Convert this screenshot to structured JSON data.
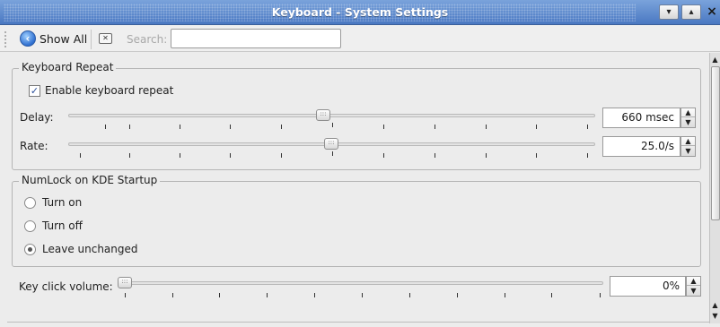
{
  "window": {
    "title": "Keyboard - System Settings",
    "buttons": {
      "menu": "▾",
      "maximize": "▴",
      "close": "×"
    }
  },
  "toolbar": {
    "show_all_label": "Show All",
    "show_all_icon": "back-arrow-icon",
    "clear_icon": "clear-search-icon",
    "search_label": "Search:",
    "search_value": ""
  },
  "keyboard_repeat": {
    "group_title": "Keyboard Repeat",
    "enable_label": "Enable keyboard repeat",
    "enable_checked": true,
    "delay_label": "Delay:",
    "delay_value": "660 msec",
    "delay_fraction": 0.48,
    "rate_label": "Rate:",
    "rate_value": "25.0/s",
    "rate_fraction": 0.49
  },
  "numlock": {
    "group_title": "NumLock on KDE Startup",
    "options": [
      {
        "label": "Turn on",
        "selected": false
      },
      {
        "label": "Turn off",
        "selected": false
      },
      {
        "label": "Leave unchanged",
        "selected": true
      }
    ]
  },
  "key_click": {
    "label": "Key click volume:",
    "value": "0%",
    "fraction": 0.0
  },
  "colors": {
    "titlebar_top": "#7aa3db",
    "titlebar_bottom": "#4a78c2",
    "background": "#ececec"
  }
}
